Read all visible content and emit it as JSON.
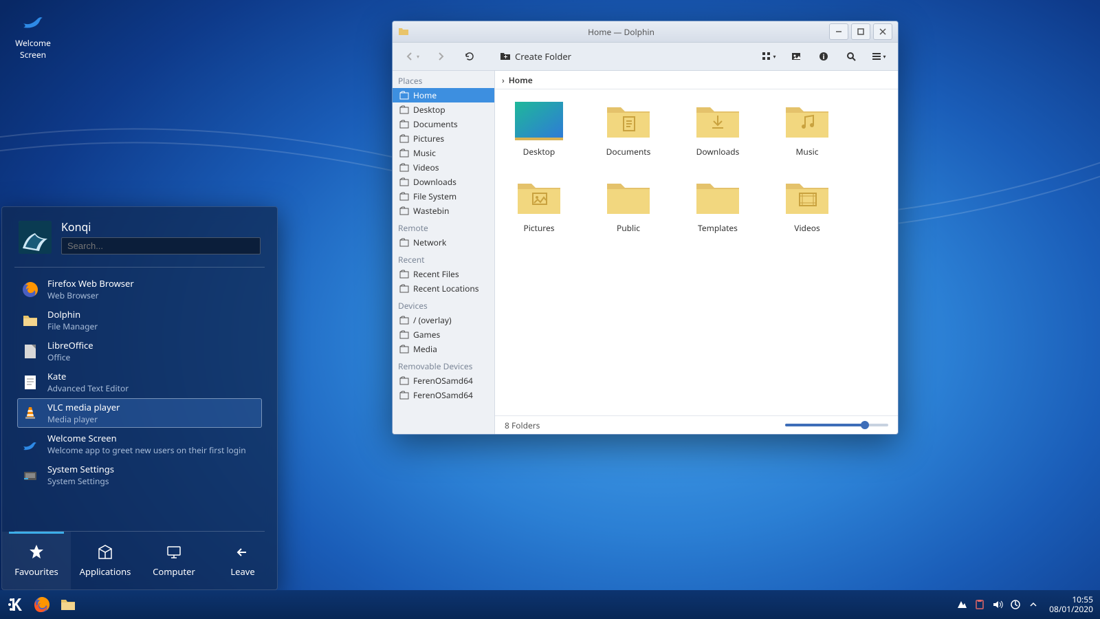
{
  "desktop_icon": {
    "label": "Welcome Screen"
  },
  "taskbar": {
    "launcher_icon": "kde-logo-icon",
    "pinned": [
      {
        "name": "firefox",
        "icon": "firefox-icon"
      },
      {
        "name": "files",
        "icon": "folder-icon"
      }
    ],
    "clock_time": "10:55",
    "clock_date": "08/01/2020"
  },
  "launcher": {
    "username": "Konqi",
    "search_placeholder": "Search...",
    "apps": [
      {
        "title": "Firefox Web Browser",
        "subtitle": "Web Browser",
        "icon": "firefox-icon"
      },
      {
        "title": "Dolphin",
        "subtitle": "File Manager",
        "icon": "folder-icon"
      },
      {
        "title": "LibreOffice",
        "subtitle": "Office",
        "icon": "libreoffice-icon"
      },
      {
        "title": "Kate",
        "subtitle": "Advanced Text Editor",
        "icon": "kate-icon"
      },
      {
        "title": "VLC media player",
        "subtitle": "Media player",
        "icon": "vlc-icon"
      },
      {
        "title": "Welcome Screen",
        "subtitle": "Welcome app to greet new users on their first login",
        "icon": "bird-icon"
      },
      {
        "title": "System Settings",
        "subtitle": "System Settings",
        "icon": "settings-icon"
      }
    ],
    "hovered_index": 4,
    "tabs": [
      {
        "label": "Favourites",
        "icon": "star-icon",
        "active": true
      },
      {
        "label": "Applications",
        "icon": "apps-icon",
        "active": false
      },
      {
        "label": "Computer",
        "icon": "computer-icon",
        "active": false
      },
      {
        "label": "Leave",
        "icon": "leave-icon",
        "active": false
      }
    ]
  },
  "dolphin": {
    "title": "Home — Dolphin",
    "toolbar": {
      "create_folder": "Create Folder"
    },
    "breadcrumb": {
      "label": "Home"
    },
    "sidebar": {
      "sections": [
        {
          "title": "Places",
          "items": [
            {
              "label": "Home",
              "icon": "home-icon",
              "selected": true
            },
            {
              "label": "Desktop",
              "icon": "desktop-icon"
            },
            {
              "label": "Documents",
              "icon": "documents-icon"
            },
            {
              "label": "Pictures",
              "icon": "pictures-icon"
            },
            {
              "label": "Music",
              "icon": "music-icon"
            },
            {
              "label": "Videos",
              "icon": "videos-icon"
            },
            {
              "label": "Downloads",
              "icon": "downloads-icon"
            },
            {
              "label": "File System",
              "icon": "filesystem-icon"
            },
            {
              "label": "Wastebin",
              "icon": "trash-icon"
            }
          ]
        },
        {
          "title": "Remote",
          "items": [
            {
              "label": "Network",
              "icon": "network-icon"
            }
          ]
        },
        {
          "title": "Recent",
          "items": [
            {
              "label": "Recent Files",
              "icon": "clock-icon"
            },
            {
              "label": "Recent Locations",
              "icon": "clock-folder-icon"
            }
          ]
        },
        {
          "title": "Devices",
          "items": [
            {
              "label": "/ (overlay)",
              "icon": "drive-icon"
            },
            {
              "label": "Games",
              "icon": "drive-icon"
            },
            {
              "label": "Media",
              "icon": "drive-icon"
            }
          ]
        },
        {
          "title": "Removable Devices",
          "items": [
            {
              "label": "FerenOSamd64",
              "icon": "usb-icon"
            },
            {
              "label": "FerenOSamd64",
              "icon": "usb-icon"
            }
          ]
        }
      ]
    },
    "files": [
      {
        "label": "Desktop",
        "type": "desktop"
      },
      {
        "label": "Documents",
        "type": "documents"
      },
      {
        "label": "Downloads",
        "type": "downloads"
      },
      {
        "label": "Music",
        "type": "music"
      },
      {
        "label": "Pictures",
        "type": "pictures"
      },
      {
        "label": "Public",
        "type": "folder"
      },
      {
        "label": "Templates",
        "type": "folder"
      },
      {
        "label": "Videos",
        "type": "videos"
      }
    ],
    "status": "8 Folders"
  }
}
